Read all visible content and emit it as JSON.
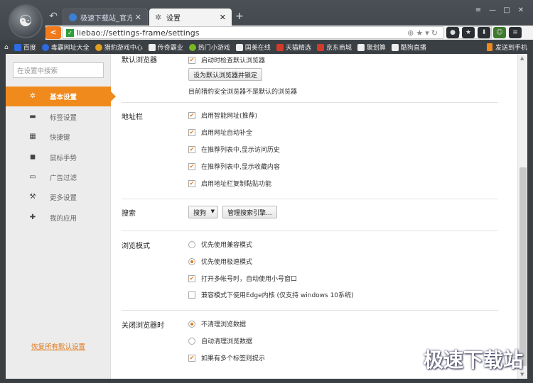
{
  "window": {
    "tabs": [
      {
        "label": "极速下载站_官方软...",
        "active": false
      },
      {
        "label": "设置",
        "active": true
      }
    ],
    "new_tab": "+",
    "controls": [
      "≡",
      "—",
      "□",
      "✕"
    ]
  },
  "address": {
    "url": "liebao://settings-frame/settings",
    "search_engine_icon": "S"
  },
  "bookmarks": {
    "items": [
      "百度",
      "毒霸网址大全",
      "猎豹游戏中心",
      "传奇霸业",
      "热门小游戏",
      "国美在线",
      "天猫精选",
      "京东商城",
      "聚划算",
      "酷狗直播"
    ],
    "right_label": "发送到手机",
    "colors": [
      "#2d6be0",
      "#2d6be0",
      "#e0a020",
      "#555555",
      "#77b820",
      "#555555",
      "#d23a2a",
      "#d23a2a",
      "#e05020",
      "#1a8ad6"
    ]
  },
  "sidebar": {
    "search_placeholder": "在设置中搜索",
    "items": [
      {
        "label": "基本设置",
        "icon": "gear-icon",
        "glyph": "✲",
        "active": true
      },
      {
        "label": "标签设置",
        "icon": "tab-icon",
        "glyph": "▬",
        "active": false
      },
      {
        "label": "快捷键",
        "icon": "keyboard-icon",
        "glyph": "▦",
        "active": false
      },
      {
        "label": "鼠标手势",
        "icon": "mouse-icon",
        "glyph": "◼",
        "active": false
      },
      {
        "label": "广告过滤",
        "icon": "filter-icon",
        "glyph": "▭",
        "active": false
      },
      {
        "label": "更多设置",
        "icon": "wrench-icon",
        "glyph": "⚒",
        "active": false
      },
      {
        "label": "我的应用",
        "icon": "puzzle-icon",
        "glyph": "✚",
        "active": false
      }
    ],
    "restore_label": "恢复所有默认设置"
  },
  "main": {
    "default_browser": {
      "title": "默认浏览器",
      "check_label": "启动时检查默认浏览器",
      "checked": true,
      "button_label": "设为默认浏览器并锁定",
      "status_text": "目前猎豹安全浏览器不是默认的浏览器"
    },
    "address_bar": {
      "title": "地址栏",
      "options": [
        {
          "label": "启用智能网址(推荐)",
          "checked": true
        },
        {
          "label": "启用网址自动补全",
          "checked": true
        },
        {
          "label": "在推荐列表中,显示访问历史",
          "checked": true
        },
        {
          "label": "在推荐列表中,显示收藏内容",
          "checked": true
        },
        {
          "label": "启用地址栏复制黏贴功能",
          "checked": true
        }
      ]
    },
    "search": {
      "title": "搜索",
      "engine_value": "搜狗",
      "manage_label": "管理搜索引擎..."
    },
    "browse_mode": {
      "title": "浏览模式",
      "radios": [
        {
          "label": "优先使用兼容模式",
          "selected": false
        },
        {
          "label": "优先使用极速模式",
          "selected": true
        }
      ],
      "checks": [
        {
          "label": "打开多帐号时，自动使用小号窗口",
          "checked": true
        },
        {
          "label": "兼容模式下使用Edge内核 (仅支持 windows 10系统)",
          "checked": false
        }
      ]
    },
    "on_close": {
      "title": "关闭浏览器时",
      "radios": [
        {
          "label": "不清理浏览数据",
          "selected": true
        },
        {
          "label": "自动清理浏览数据",
          "selected": false
        }
      ],
      "checks": [
        {
          "label": "如果有多个标签则提示",
          "checked": true
        }
      ]
    }
  },
  "watermark": "极速下载站",
  "accent_color": "#f08a1c"
}
